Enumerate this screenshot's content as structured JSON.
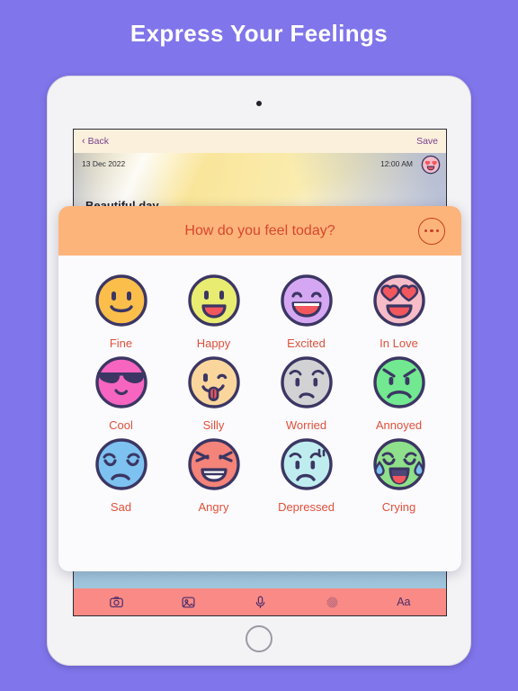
{
  "headline": "Express Your Feelings",
  "theme": {
    "background": "#8075EA",
    "modal_header": "#FCB47B",
    "modal_title_color": "#D9472C",
    "label_color": "#E0513A",
    "toolbar": "#F98A85",
    "nav_bar": "#FAF0DC",
    "nav_link_color": "#7B3F8F",
    "outline": "#3B3663"
  },
  "note": {
    "back_label": "Back",
    "save_label": "Save",
    "date": "13 Dec 2022",
    "time": "12:00 AM",
    "title": "Beautiful day",
    "mood_badge": "in-love",
    "toolbar_items": [
      {
        "icon": "camera-icon",
        "label": ""
      },
      {
        "icon": "image-icon",
        "label": ""
      },
      {
        "icon": "microphone-icon",
        "label": ""
      },
      {
        "icon": "brush-pattern-icon",
        "label": ""
      },
      {
        "icon": "text-format-icon",
        "label": "Aa"
      }
    ]
  },
  "modal": {
    "title": "How do you feel today?",
    "more_button": "more-options",
    "moods": [
      {
        "label": "Fine",
        "face": "#FBBE4B",
        "shade": "#E9A92F",
        "mouth": "smile",
        "eyes": "dots",
        "extra": "none"
      },
      {
        "label": "Happy",
        "face": "#E8EC71",
        "shade": "#D2D756",
        "mouth": "open-grin",
        "eyes": "dots",
        "extra": "none"
      },
      {
        "label": "Excited",
        "face": "#D5A7F2",
        "shade": "#C08FE4",
        "mouth": "open-grin",
        "eyes": "arch-happy",
        "extra": "none"
      },
      {
        "label": "In Love",
        "face": "#F6BCC8",
        "shade": "#EDA5B6",
        "mouth": "open-grin",
        "eyes": "hearts",
        "extra": "none"
      },
      {
        "label": "Cool",
        "face": "#F765C0",
        "shade": "#E24FAC",
        "mouth": "smirk",
        "eyes": "sunglasses",
        "extra": "none"
      },
      {
        "label": "Silly",
        "face": "#FBD69C",
        "shade": "#EEC184",
        "mouth": "tongue",
        "eyes": "wink",
        "extra": "none"
      },
      {
        "label": "Worried",
        "face": "#D2D2D4",
        "shade": "#BEBEC1",
        "mouth": "frown",
        "eyes": "dots",
        "extra": "worried-brows"
      },
      {
        "label": "Annoyed",
        "face": "#72E890",
        "shade": "#59D17A",
        "mouth": "frown",
        "eyes": "dots",
        "extra": "angry-brows"
      },
      {
        "label": "Sad",
        "face": "#7DC2F0",
        "shade": "#5FAEE4",
        "mouth": "frown",
        "eyes": "closed-sad",
        "extra": "none"
      },
      {
        "label": "Angry",
        "face": "#F48379",
        "shade": "#E56C61",
        "mouth": "teeth",
        "eyes": "scrunched",
        "extra": "none"
      },
      {
        "label": "Depressed",
        "face": "#BFEDEF",
        "shade": "#A4DFE2",
        "mouth": "frown",
        "eyes": "dots",
        "extra": "sweat"
      },
      {
        "label": "Crying",
        "face": "#8FE08A",
        "shade": "#76CE73",
        "mouth": "wail",
        "eyes": "closed-sad",
        "extra": "tears"
      }
    ]
  }
}
